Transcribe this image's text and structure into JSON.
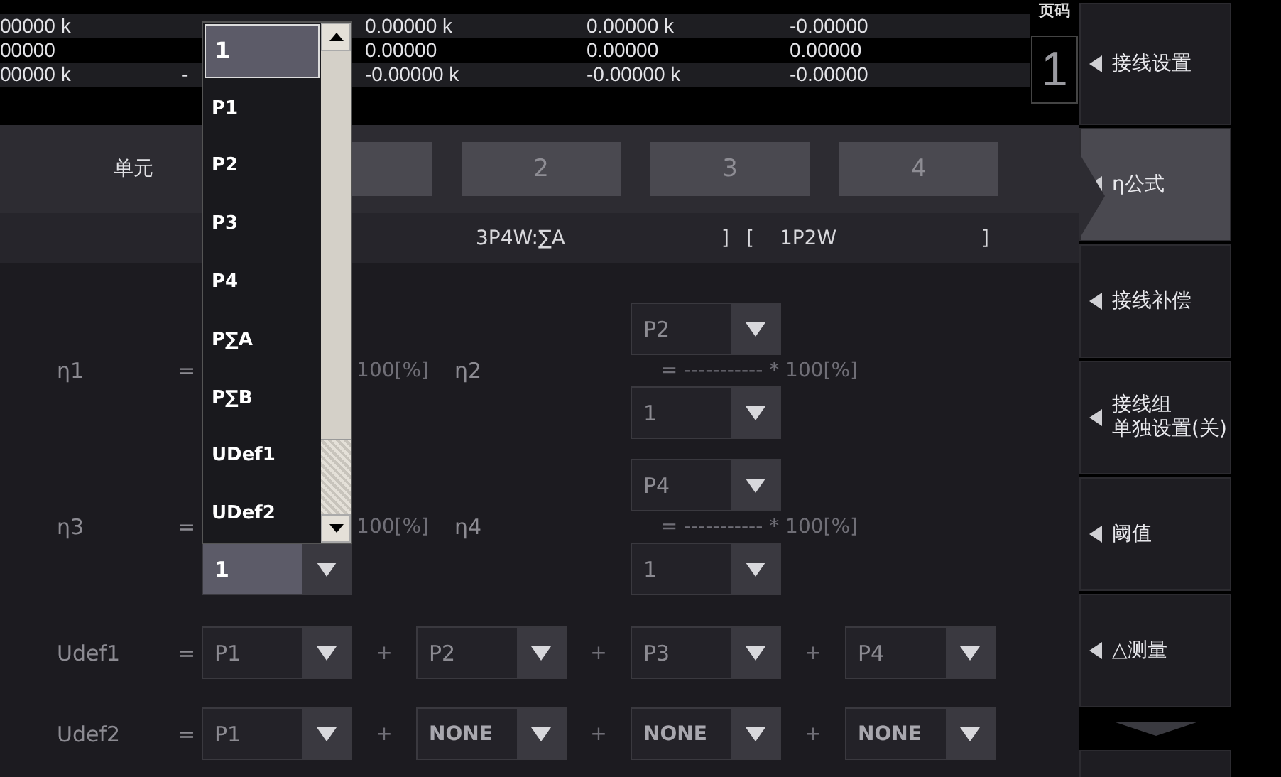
{
  "data_table": {
    "rows": [
      {
        "col_1": "00000 k",
        "col_3": "0.00000 k",
        "col_4": "0.00000 k",
        "col_5": "-0.00000"
      },
      {
        "col_1": "00000",
        "col_3": "0.00000",
        "col_4": "0.00000",
        "col_5": "0.00000"
      },
      {
        "col_1": "00000 k",
        "col_2": "-",
        "col_3": "-0.00000 k",
        "col_4": "-0.00000 k",
        "col_5": "-0.00000"
      }
    ]
  },
  "page": {
    "label": "页码",
    "value": "1"
  },
  "dialog": {
    "unit_label": "单元",
    "unit_tabs": [
      {
        "selected": false
      },
      {
        "label": "2",
        "selected": false
      },
      {
        "label": "3",
        "selected": false
      },
      {
        "label": "4",
        "selected": false
      }
    ],
    "wiring": {
      "left": "3P4W:∑A",
      "open_bracket_close": "]",
      "bracket_open": "[",
      "right": "1P2W",
      "bracket_close": "]"
    },
    "formulas": [
      {
        "label": "η1",
        "equals": "=",
        "line": "100[%]"
      },
      {
        "label": "η2",
        "line": "= ----------- * 100[%]",
        "numerator": {
          "value": "P2",
          "active": false
        },
        "denominator": {
          "value": "1",
          "active": false
        }
      },
      {
        "label": "η3",
        "equals": "=",
        "line": "100[%]",
        "denominator": {
          "value": "1",
          "active": true
        }
      },
      {
        "label": "η4",
        "line": "= ----------- * 100[%]",
        "numerator": {
          "value": "P4",
          "active": false
        },
        "denominator": {
          "value": "1",
          "active": false
        }
      }
    ],
    "user_defined": [
      {
        "label": "Udef1",
        "equals": "=",
        "terms": [
          {
            "value": "P1",
            "active": false
          },
          {
            "operator": "+",
            "value": "P2",
            "active": false
          },
          {
            "operator": "+",
            "value": "P3",
            "active": false
          },
          {
            "operator": "+",
            "value": "P4",
            "active": false
          }
        ]
      },
      {
        "label": "Udef2",
        "equals": "=",
        "terms": [
          {
            "value": "P1",
            "active": false
          },
          {
            "operator": "+",
            "value": "NONE",
            "active": false
          },
          {
            "operator": "+",
            "value": "NONE",
            "active": false
          },
          {
            "operator": "+",
            "value": "NONE",
            "active": false
          }
        ]
      }
    ],
    "open_list": {
      "items": [
        {
          "label": "1",
          "selected": true
        },
        {
          "label": "P1",
          "selected": false
        },
        {
          "label": "P2",
          "selected": false
        },
        {
          "label": "P3",
          "selected": false
        },
        {
          "label": "P4",
          "selected": false
        },
        {
          "label": "P∑A",
          "selected": false
        },
        {
          "label": "P∑B",
          "selected": false
        },
        {
          "label": "UDef1",
          "selected": false
        },
        {
          "label": "UDef2",
          "selected": false
        }
      ]
    }
  },
  "sidebar": {
    "items": [
      {
        "label": "接线设置",
        "selected": false
      },
      {
        "label": "η公式",
        "selected": true
      },
      {
        "label": "接线补偿",
        "selected": false
      },
      {
        "lines": [
          "接线组",
          "单独设置(关)"
        ],
        "selected": false
      },
      {
        "label": "阈值",
        "selected": false
      },
      {
        "label": "△测量",
        "selected": false
      }
    ]
  }
}
